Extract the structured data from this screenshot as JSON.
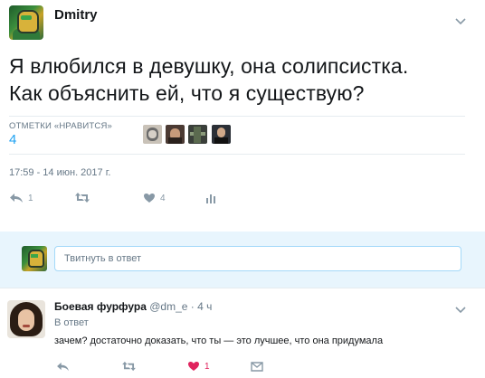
{
  "tweet": {
    "author": "Dmitry",
    "text_line1": "Я влюбился в девушку, она солипсистка.",
    "text_line2": "Как объяснить ей, что я существую?",
    "likes_label": "ОТМЕТКИ «НРАВИТСЯ»",
    "likes_count": "4",
    "timestamp": "17:59 - 14 июн. 2017 г.",
    "actions": {
      "reply_count": "1",
      "retweet_count": "",
      "like_count": "4"
    }
  },
  "reply_box": {
    "placeholder": "Твитнуть в ответ"
  },
  "reply": {
    "name": "Боевая фурфура",
    "handle": "@dm_e",
    "separator": "·",
    "time": "4 ч",
    "reply_to": "В ответ",
    "text": "зачем? достаточно доказать, что ты — это лучшее, что она придумала",
    "actions": {
      "reply_count": "",
      "retweet_count": "",
      "like_count": "1"
    }
  },
  "colors": {
    "accent": "#1da1f2",
    "like_active": "#e0245e",
    "icon_gray": "#8899a6",
    "reply_box_bg": "#e8f5fd"
  },
  "icons": [
    "chevron-down-icon",
    "reply-icon",
    "retweet-icon",
    "like-icon",
    "analytics-icon",
    "direct-message-icon"
  ]
}
